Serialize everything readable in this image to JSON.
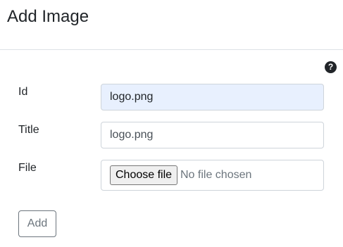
{
  "header": {
    "title": "Add Image"
  },
  "help": {
    "icon": "question-circle-icon",
    "glyph": "?"
  },
  "form": {
    "id": {
      "label": "Id",
      "value": "logo.png"
    },
    "title": {
      "label": "Title",
      "value": "logo.png"
    },
    "file": {
      "label": "File",
      "button_label": "Choose file",
      "status": "No file chosen"
    },
    "submit_label": "Add"
  }
}
